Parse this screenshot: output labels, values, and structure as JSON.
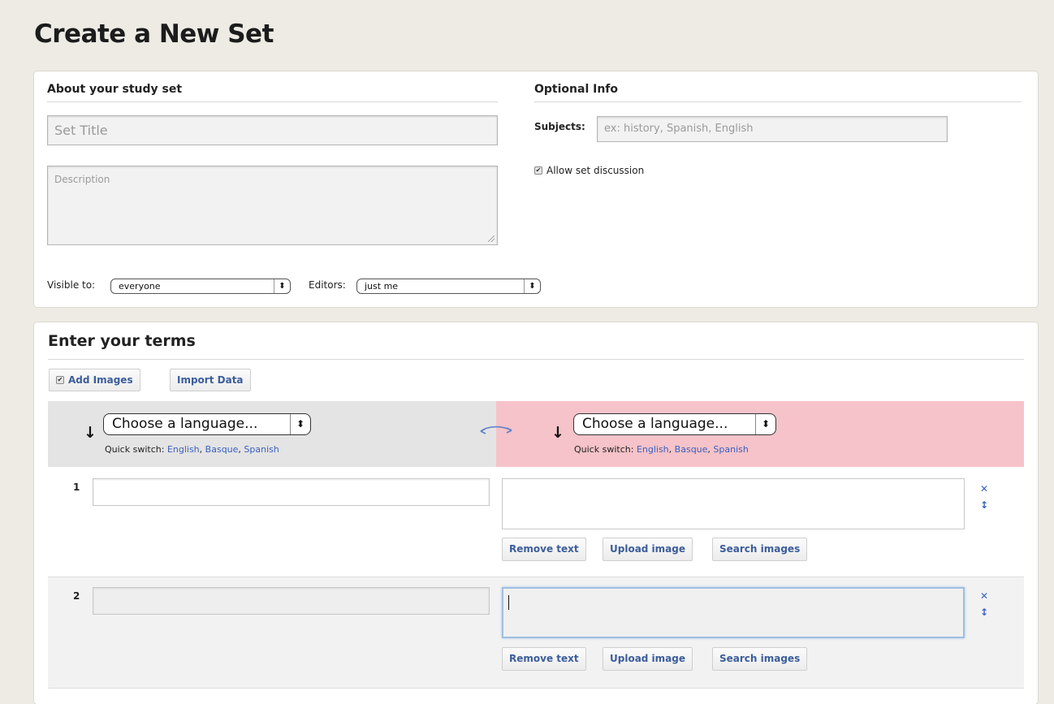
{
  "page": {
    "title": "Create a New Set"
  },
  "about": {
    "heading": "About your study set",
    "title_placeholder": "Set Title",
    "description_placeholder": "Description",
    "visible_label": "Visible to:",
    "visible_value": "everyone",
    "editors_label": "Editors:",
    "editors_value": "just me"
  },
  "optional": {
    "heading": "Optional Info",
    "subjects_label": "Subjects:",
    "subjects_placeholder": "ex: history, Spanish, English",
    "discussion_label": "Allow set discussion",
    "discussion_checked": true
  },
  "terms": {
    "heading": "Enter your terms",
    "add_images_label": "Add Images",
    "import_label": "Import Data",
    "language_placeholder": "Choose a language...",
    "quick_switch_label": "Quick switch:",
    "quick_languages": [
      "English",
      "Basque",
      "Spanish"
    ],
    "rows": [
      {
        "number": "1",
        "term": "",
        "definition": ""
      },
      {
        "number": "2",
        "term": "",
        "definition": ""
      }
    ],
    "remove_text_label": "Remove text",
    "upload_image_label": "Upload image",
    "search_images_label": "Search images"
  },
  "colors": {
    "page_bg": "#edebe4",
    "link_blue": "#3b5fc0",
    "right_lang_bg": "#f5c3c9"
  },
  "icons": {
    "arrow_down": "↓",
    "select_arrows": "⬍",
    "delete": "✕",
    "reorder": "↕",
    "swap": "swap-arrows-icon",
    "check": "✔"
  }
}
